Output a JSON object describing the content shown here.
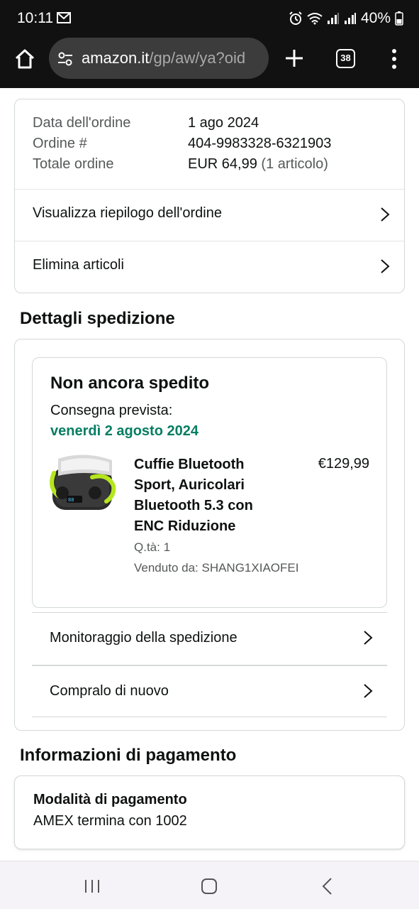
{
  "status_bar": {
    "time": "10:11",
    "battery": "40%",
    "icons": [
      "mail-icon",
      "alarm-icon",
      "wifi-icon",
      "signal-icon",
      "battery-icon"
    ]
  },
  "browser": {
    "url_domain": "amazon.it",
    "url_path": "/gp/aw/ya?oid",
    "tab_count": "38"
  },
  "order_info": {
    "date_label": "Data dell'ordine",
    "date_value": "1 ago 2024",
    "order_label": "Ordine #",
    "order_value": "404-9983328-6321903",
    "total_label": "Totale ordine",
    "total_value": "EUR 64,99",
    "total_items": "(1 articolo)",
    "link_summary": "Visualizza riepilogo dell'ordine",
    "link_delete": "Elimina articoli"
  },
  "shipping": {
    "section_title": "Dettagli spedizione",
    "status": "Non ancora spedito",
    "eta_label": "Consegna prevista:",
    "eta_date": "venerdì 2 agosto 2024",
    "product": {
      "title": "Cuffie Bluetooth Sport, Auricolari Bluetooth 5.3 con ENC Riduzione",
      "price": "€129,99",
      "qty": "Q.tà: 1",
      "seller": "Venduto da: SHANG1XIAOFEI"
    },
    "link_track": "Monitoraggio della spedizione",
    "link_buy_again": "Compralo di nuovo"
  },
  "payment": {
    "section_title": "Informazioni di pagamento",
    "method_label": "Modalità di pagamento",
    "method_value": "AMEX  termina con 1002"
  },
  "colors": {
    "delivery_green": "#067d62",
    "browser_chrome": "#111111",
    "border": "#d5d9d9"
  }
}
